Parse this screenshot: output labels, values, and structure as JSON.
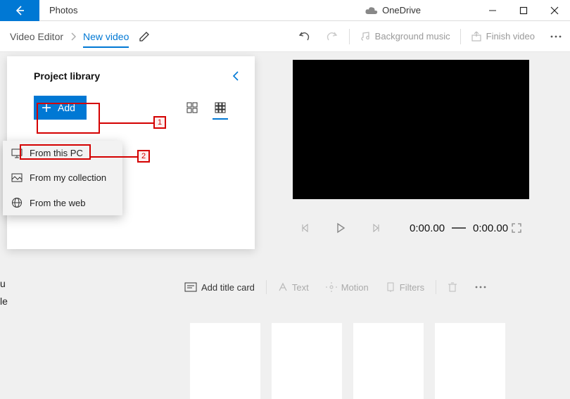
{
  "titlebar": {
    "app_name": "Photos",
    "onedrive": "OneDrive"
  },
  "breadcrumb": {
    "parent": "Video Editor",
    "current": "New video"
  },
  "toolbar": {
    "bg_music": "Background music",
    "finish": "Finish video"
  },
  "library": {
    "title": "Project library",
    "add_label": "Add"
  },
  "add_menu": {
    "from_pc": "From this PC",
    "from_collection": "From my collection",
    "from_web": "From the web"
  },
  "player": {
    "time_current": "0:00.00",
    "time_total": "0:00.00"
  },
  "edit_toolbar": {
    "title_card": "Add title card",
    "text": "Text",
    "motion": "Motion",
    "filters": "Filters"
  },
  "annotations": {
    "one": "1",
    "two": "2"
  },
  "cutoff": {
    "a": "u",
    "b": "le"
  }
}
